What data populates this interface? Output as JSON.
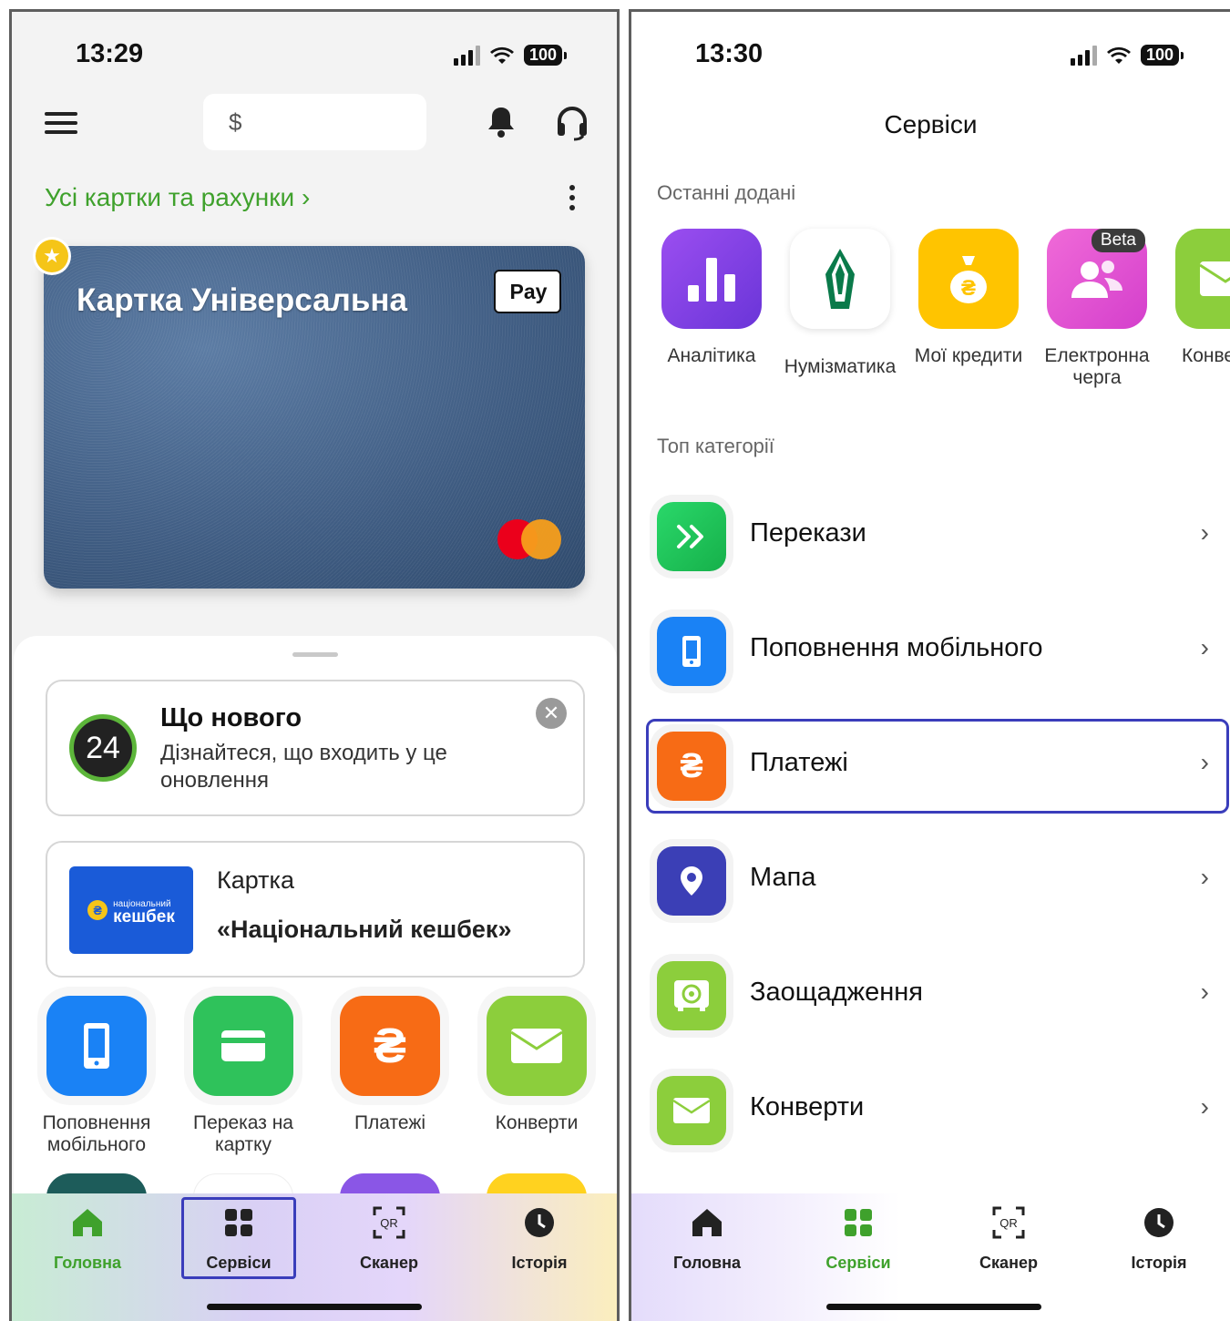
{
  "left": {
    "status": {
      "time": "13:29",
      "battery": "100"
    },
    "balance": "$",
    "accounts_link": "Усі картки та рахунки ›",
    "card": {
      "title": "Картка Універсальна",
      "pay_label": "Pay"
    },
    "news": {
      "badge": "24",
      "title": "Що нового",
      "text": "Дізнайтеся, що входить у це оновлення"
    },
    "promo": {
      "image_small": "національний",
      "image_big": "кешбек",
      "line1": "Картка",
      "line2": "«Національний кешбек»"
    },
    "quick": [
      {
        "label": "Поповнення мобільного",
        "icon": "phone-icon",
        "color": "#1a82f5"
      },
      {
        "label": "Переказ на картку",
        "icon": "card-icon",
        "color": "#2fc25b"
      },
      {
        "label": "Платежі",
        "icon": "hryvnia-icon",
        "color": "#f76b15"
      },
      {
        "label": "Конверти",
        "icon": "envelope-icon",
        "color": "#8cce3c"
      }
    ],
    "tabs": [
      {
        "label": "Головна",
        "icon": "home-icon",
        "active": true
      },
      {
        "label": "Сервіси",
        "icon": "grid-icon",
        "active": false
      },
      {
        "label": "Сканер",
        "icon": "qr-icon",
        "active": false
      },
      {
        "label": "Історія",
        "icon": "clock-icon",
        "active": false
      }
    ]
  },
  "right": {
    "status": {
      "time": "13:30",
      "battery": "100"
    },
    "title": "Сервіси",
    "recent_header": "Останні додані",
    "recent": [
      {
        "label": "Аналітика",
        "icon": "chart-icon",
        "color": "#7a3fe0"
      },
      {
        "label": "Нумізматика",
        "icon": "numismatics-icon",
        "color": "#ffffff"
      },
      {
        "label": "Мої кредити",
        "icon": "money-bag-icon",
        "color": "#ffc400"
      },
      {
        "label": "Електронна черга",
        "icon": "people-icon",
        "color": "#e052d8",
        "badge": "Beta"
      },
      {
        "label": "Конве",
        "icon": "envelope-icon",
        "color": "#8cce3c"
      }
    ],
    "top_header": "Топ категорії",
    "categories": [
      {
        "label": "Перекази",
        "icon": "transfer-icon",
        "color": "#22c55e"
      },
      {
        "label": "Поповнення мобільного",
        "icon": "phone-icon",
        "color": "#1a82f5"
      },
      {
        "label": "Платежі",
        "icon": "hryvnia-icon",
        "color": "#f76b15"
      },
      {
        "label": "Мапа",
        "icon": "map-pin-icon",
        "color": "#3b3fb6"
      },
      {
        "label": "Заощадження",
        "icon": "safe-icon",
        "color": "#8cce3c"
      },
      {
        "label": "Конверти",
        "icon": "envelope-icon",
        "color": "#8cce3c"
      }
    ],
    "tabs": [
      {
        "label": "Головна",
        "icon": "home-icon",
        "active": false
      },
      {
        "label": "Сервіси",
        "icon": "grid-icon",
        "active": true
      },
      {
        "label": "Сканер",
        "icon": "qr-icon",
        "active": false
      },
      {
        "label": "Історія",
        "icon": "clock-icon",
        "active": false
      }
    ]
  },
  "colors": {
    "accent_green": "#3fa12c",
    "highlight": "#3a3dbb"
  }
}
